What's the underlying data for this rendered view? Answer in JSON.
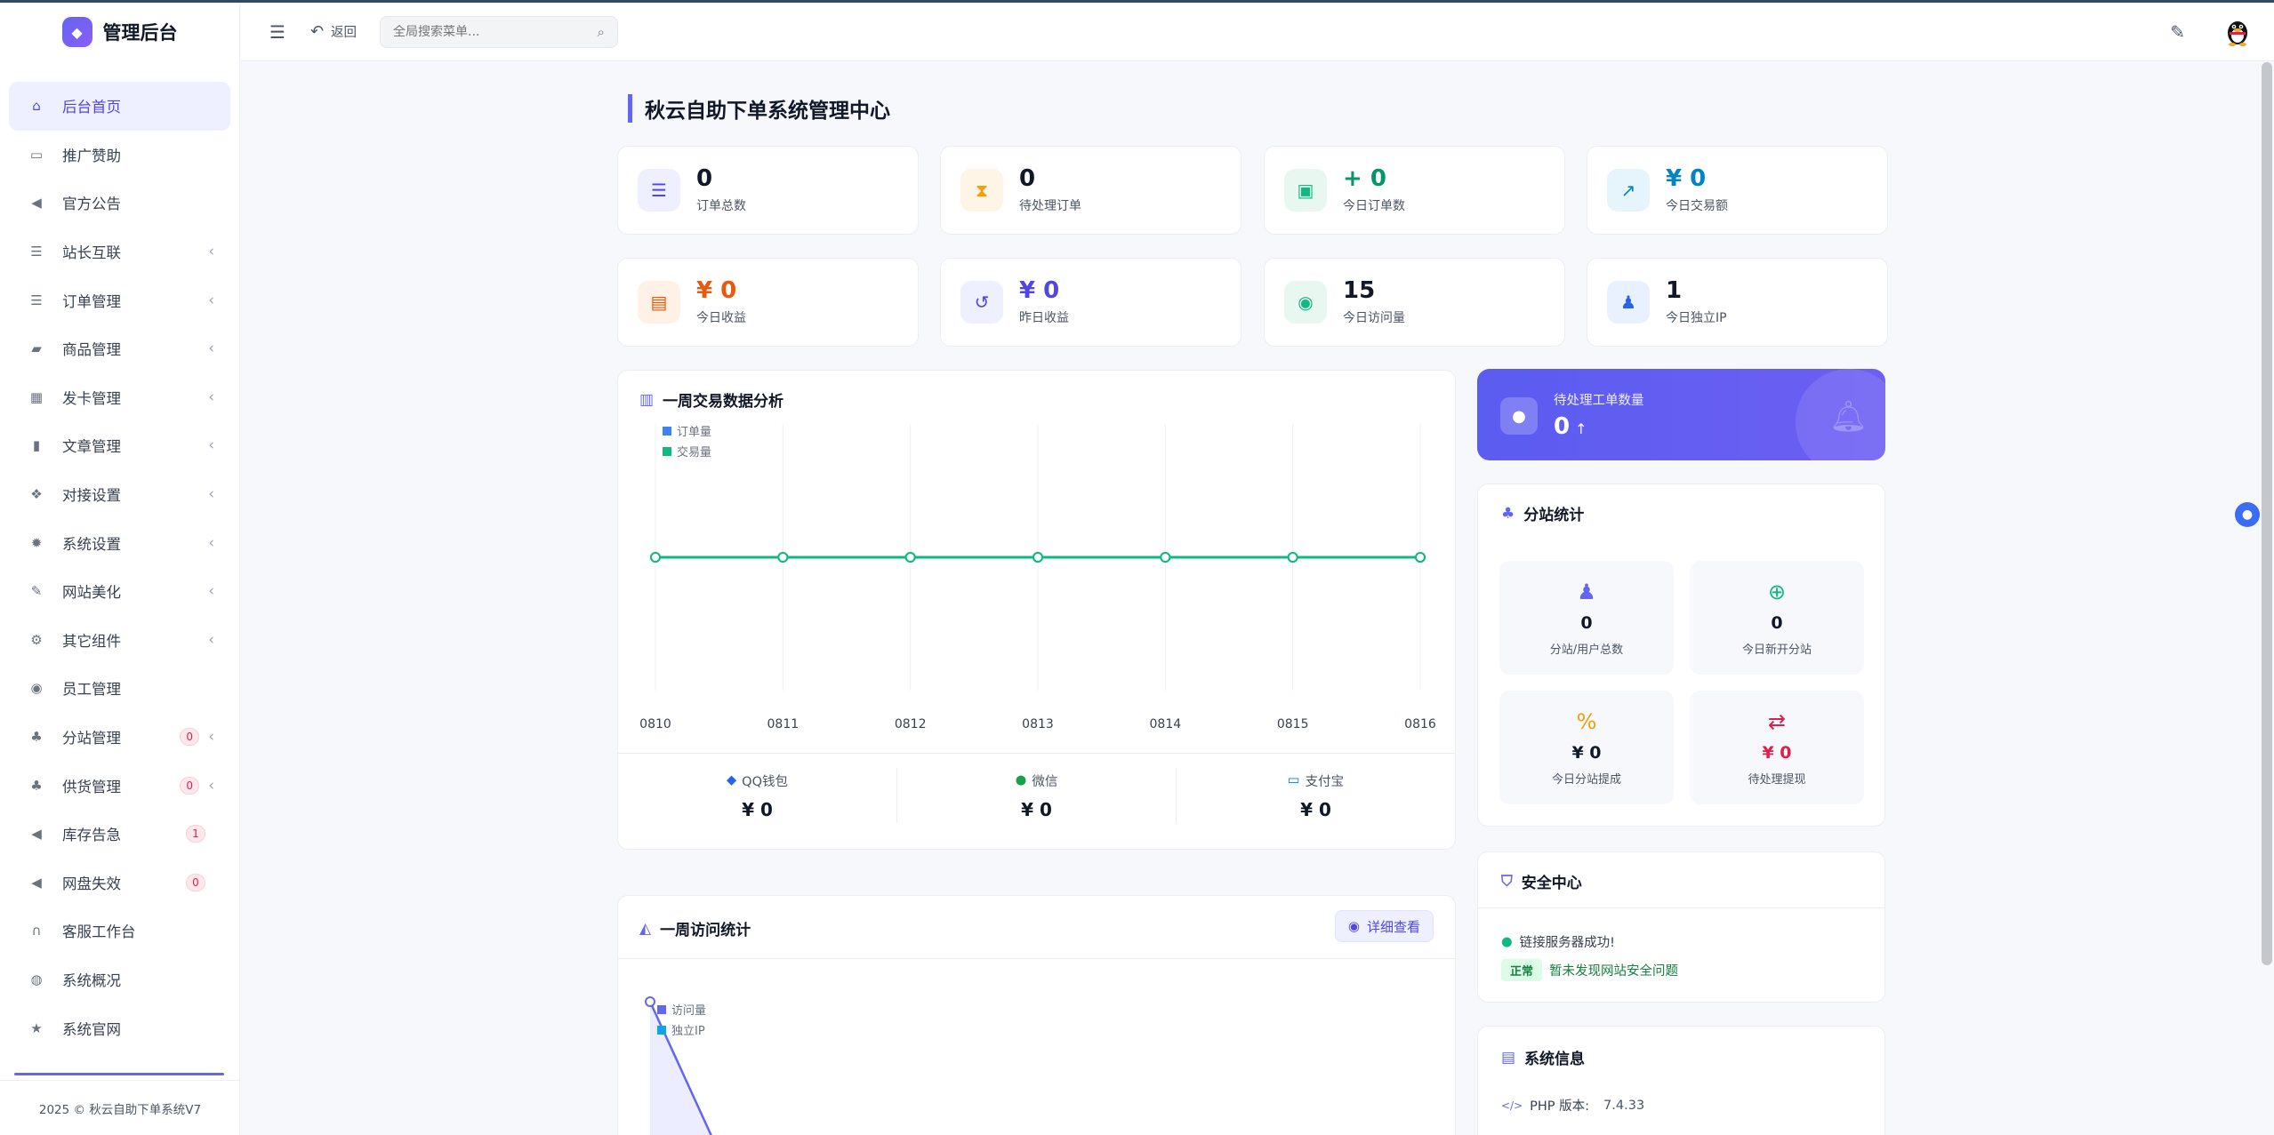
{
  "brand": {
    "title": "管理后台"
  },
  "sidebar": {
    "items": [
      {
        "label": "后台首页",
        "icon": "home-icon",
        "glyph": "⌂",
        "active": true
      },
      {
        "label": "推广赞助",
        "icon": "image-icon",
        "glyph": "▭"
      },
      {
        "label": "官方公告",
        "icon": "megaphone-icon",
        "glyph": "◀"
      },
      {
        "label": "站长互联",
        "icon": "list-icon",
        "glyph": "☰",
        "chevron": true
      },
      {
        "label": "订单管理",
        "icon": "list-icon",
        "glyph": "☰",
        "chevron": true
      },
      {
        "label": "商品管理",
        "icon": "cart-icon",
        "glyph": "▰",
        "chevron": true
      },
      {
        "label": "发卡管理",
        "icon": "grid-icon",
        "glyph": "▦",
        "chevron": true
      },
      {
        "label": "文章管理",
        "icon": "book-icon",
        "glyph": "▮",
        "chevron": true
      },
      {
        "label": "对接设置",
        "icon": "cubes-icon",
        "glyph": "❖",
        "chevron": true
      },
      {
        "label": "系统设置",
        "icon": "gear-icon",
        "glyph": "✹",
        "chevron": true
      },
      {
        "label": "网站美化",
        "icon": "brush-icon",
        "glyph": "✎",
        "chevron": true
      },
      {
        "label": "其它组件",
        "icon": "cogs-icon",
        "glyph": "⚙",
        "chevron": true
      },
      {
        "label": "员工管理",
        "icon": "user-circle-icon",
        "glyph": "◉"
      },
      {
        "label": "分站管理",
        "icon": "sitemap-icon",
        "glyph": "♣",
        "badge": "0",
        "chevron": true
      },
      {
        "label": "供货管理",
        "icon": "sitemap-icon",
        "glyph": "♣",
        "badge": "0",
        "chevron": true
      },
      {
        "label": "库存告急",
        "icon": "megaphone-icon",
        "glyph": "◀",
        "badge": "1"
      },
      {
        "label": "网盘失效",
        "icon": "megaphone-icon",
        "glyph": "◀",
        "badge": "0"
      },
      {
        "label": "客服工作台",
        "icon": "headset-icon",
        "glyph": "∩"
      },
      {
        "label": "系统概况",
        "icon": "gamepad-icon",
        "glyph": "◍"
      },
      {
        "label": "系统官网",
        "icon": "star-icon",
        "glyph": "★"
      }
    ],
    "footer": "2025 © 秋云自助下单系统V7"
  },
  "topbar": {
    "back_label": "返回",
    "search_placeholder": "全局搜索菜单..."
  },
  "page": {
    "title": "秋云自助下单系统管理中心"
  },
  "stats": [
    {
      "value": "0",
      "label": "订单总数",
      "icon": "list-ol-icon",
      "glyph": "☰",
      "color": "#4f46e5",
      "bg": "#eef0ff",
      "valcolor": "#111827"
    },
    {
      "value": "0",
      "label": "待处理订单",
      "icon": "hourglass-icon",
      "glyph": "⧗",
      "color": "#f59e0b",
      "bg": "#fff5e6",
      "valcolor": "#111827"
    },
    {
      "value": "+ 0",
      "label": "今日订单数",
      "icon": "calendar-check-icon",
      "glyph": "▣",
      "color": "#10b981",
      "bg": "#e8f8f1",
      "valcolor": "#059669"
    },
    {
      "value": "¥ 0",
      "label": "今日交易额",
      "icon": "chart-line-icon",
      "glyph": "↗",
      "color": "#0284c7",
      "bg": "#e6f4fb",
      "valcolor": "#0284c7"
    },
    {
      "value": "¥ 0",
      "label": "今日收益",
      "icon": "money-bill-icon",
      "glyph": "▤",
      "color": "#ea580c",
      "bg": "#fff1e6",
      "valcolor": "#ea580c"
    },
    {
      "value": "¥ 0",
      "label": "昨日收益",
      "icon": "history-icon",
      "glyph": "↺",
      "color": "#4f46e5",
      "bg": "#eef0ff",
      "valcolor": "#4f46e5"
    },
    {
      "value": "15",
      "label": "今日访问量",
      "icon": "eye-icon",
      "glyph": "◉",
      "color": "#10b981",
      "bg": "#e8f8f1",
      "valcolor": "#111827"
    },
    {
      "value": "1",
      "label": "今日独立IP",
      "icon": "users-icon",
      "glyph": "♟",
      "color": "#2563eb",
      "bg": "#eaf1fe",
      "valcolor": "#111827"
    }
  ],
  "weekly_trade": {
    "title": "一周交易数据分析",
    "payments": [
      {
        "name": "QQ钱包",
        "amount": "¥ 0",
        "icon": "qq-icon",
        "glyph": "◆",
        "color": "#2563eb"
      },
      {
        "name": "微信",
        "amount": "¥ 0",
        "icon": "wechat-icon",
        "glyph": "●",
        "color": "#16a34a"
      },
      {
        "name": "支付宝",
        "amount": "¥ 0",
        "icon": "credit-card-icon",
        "glyph": "▭",
        "color": "#0284c7"
      }
    ]
  },
  "chart_data": [
    {
      "type": "line",
      "categories": [
        "0810",
        "0811",
        "0812",
        "0813",
        "0814",
        "0815",
        "0816"
      ],
      "series": [
        {
          "name": "订单量",
          "values": [
            0,
            0,
            0,
            0,
            0,
            0,
            0
          ],
          "color": "#3b82f6"
        },
        {
          "name": "交易量",
          "values": [
            0,
            0,
            0,
            0,
            0,
            0,
            0
          ],
          "color": "#10b981"
        }
      ],
      "legend": "top-left"
    },
    {
      "type": "area",
      "series": [
        {
          "name": "访问量",
          "color": "#6366f1"
        },
        {
          "name": "独立IP",
          "color": "#0ea5e9"
        }
      ],
      "legend": "top-left"
    }
  ],
  "ticket": {
    "label": "待处理工单数量",
    "value": "0",
    "arrow": "↑"
  },
  "substations": {
    "title": "分站统计",
    "tiles": [
      {
        "value": "0",
        "label": "分站/用户总数",
        "icon": "users-icon",
        "glyph": "♟",
        "color": "#6366f1",
        "valcolor": "#111827"
      },
      {
        "value": "0",
        "label": "今日新开分站",
        "icon": "plus-circle-icon",
        "glyph": "⊕",
        "color": "#10b981",
        "valcolor": "#111827"
      },
      {
        "value": "¥ 0",
        "label": "今日分站提成",
        "icon": "percent-icon",
        "glyph": "%",
        "color": "#f59e0b",
        "valcolor": "#111827"
      },
      {
        "value": "¥ 0",
        "label": "待处理提现",
        "icon": "exchange-icon",
        "glyph": "⇄",
        "color": "#e11d48",
        "valcolor": "#e11d48"
      }
    ]
  },
  "security": {
    "title": "安全中心",
    "status_line": "链接服务器成功!",
    "tag": "正常",
    "message": "暂未发现网站安全问题"
  },
  "weekly_visit": {
    "title": "一周访问统计",
    "detail_label": "详细查看"
  },
  "sysinfo": {
    "title": "系统信息",
    "php_label": "PHP 版本:",
    "php_value": "7.4.33"
  },
  "colors": {
    "accent": "#6366f1"
  }
}
